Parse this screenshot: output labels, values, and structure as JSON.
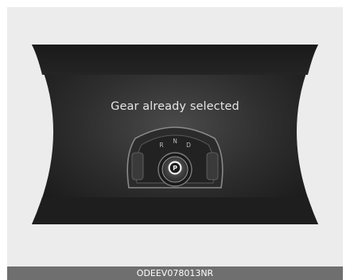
{
  "display": {
    "message": "Gear already selected"
  },
  "shifter": {
    "gear_labels": [
      "R",
      "N",
      "D"
    ],
    "park_label": "P"
  },
  "image": {
    "code": "ODEEV078013NR"
  },
  "colors": {
    "background": "#ececec",
    "cluster_dark": "#1f1f1f",
    "text": "#e6e6e6",
    "caption_bar": "#6f6f6f"
  }
}
